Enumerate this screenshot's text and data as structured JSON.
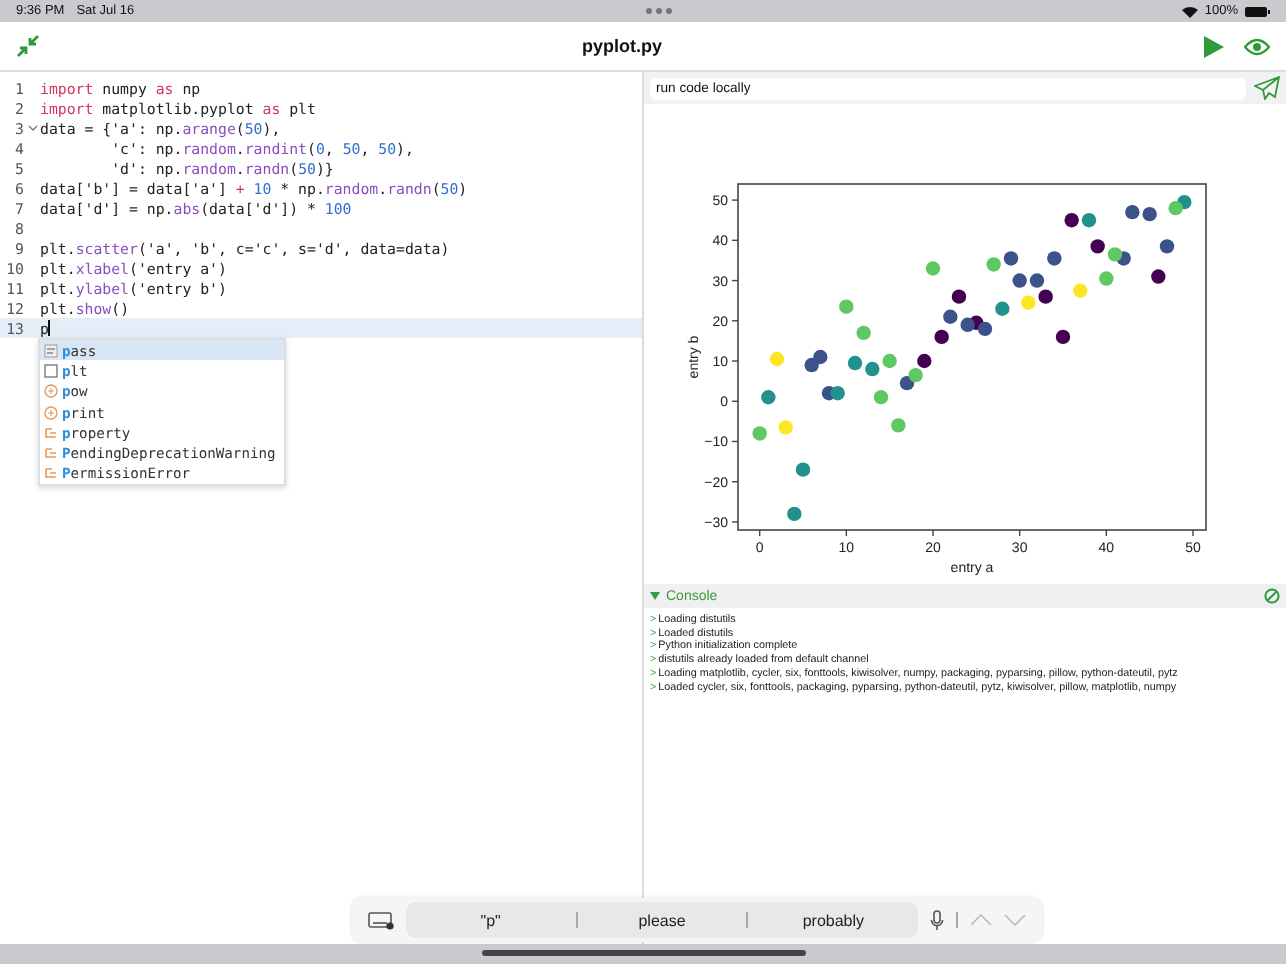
{
  "status_bar": {
    "time": "9:36 PM",
    "date": "Sat Jul 16",
    "battery": "100%"
  },
  "header": {
    "title": "pyplot.py"
  },
  "editor": {
    "lines": [
      {
        "number": "1",
        "tokens": [
          {
            "text": "import",
            "kind": "keyword"
          },
          {
            "text": " numpy ",
            "kind": "plain"
          },
          {
            "text": "as",
            "kind": "keyword"
          },
          {
            "text": " np",
            "kind": "plain"
          }
        ]
      },
      {
        "number": "2",
        "tokens": [
          {
            "text": "import",
            "kind": "keyword"
          },
          {
            "text": " matplotlib.pyplot ",
            "kind": "plain"
          },
          {
            "text": "as",
            "kind": "keyword"
          },
          {
            "text": " plt",
            "kind": "plain"
          }
        ]
      },
      {
        "number": "3",
        "foldable": true,
        "tokens": [
          {
            "text": "data = {'a': np.",
            "kind": "plain"
          },
          {
            "text": "arange",
            "kind": "call"
          },
          {
            "text": "(",
            "kind": "plain"
          },
          {
            "text": "50",
            "kind": "number"
          },
          {
            "text": "),",
            "kind": "plain"
          }
        ]
      },
      {
        "number": "4",
        "tokens": [
          {
            "text": "        'c': np.",
            "kind": "plain"
          },
          {
            "text": "random",
            "kind": "call"
          },
          {
            "text": ".",
            "kind": "plain"
          },
          {
            "text": "randint",
            "kind": "call"
          },
          {
            "text": "(",
            "kind": "plain"
          },
          {
            "text": "0",
            "kind": "number"
          },
          {
            "text": ", ",
            "kind": "plain"
          },
          {
            "text": "50",
            "kind": "number"
          },
          {
            "text": ", ",
            "kind": "plain"
          },
          {
            "text": "50",
            "kind": "number"
          },
          {
            "text": "),",
            "kind": "plain"
          }
        ]
      },
      {
        "number": "5",
        "tokens": [
          {
            "text": "        'd': np.",
            "kind": "plain"
          },
          {
            "text": "random",
            "kind": "call"
          },
          {
            "text": ".",
            "kind": "plain"
          },
          {
            "text": "randn",
            "kind": "call"
          },
          {
            "text": "(",
            "kind": "plain"
          },
          {
            "text": "50",
            "kind": "number"
          },
          {
            "text": ")}",
            "kind": "plain"
          }
        ]
      },
      {
        "number": "6",
        "tokens": [
          {
            "text": "data['b'] = data['a'] ",
            "kind": "plain"
          },
          {
            "text": "+ ",
            "kind": "keyword"
          },
          {
            "text": "10",
            "kind": "number"
          },
          {
            "text": " * np.",
            "kind": "plain"
          },
          {
            "text": "random",
            "kind": "call"
          },
          {
            "text": ".",
            "kind": "plain"
          },
          {
            "text": "randn",
            "kind": "call"
          },
          {
            "text": "(",
            "kind": "plain"
          },
          {
            "text": "50",
            "kind": "number"
          },
          {
            "text": ")",
            "kind": "plain"
          }
        ]
      },
      {
        "number": "7",
        "tokens": [
          {
            "text": "data['d'] = np.",
            "kind": "plain"
          },
          {
            "text": "abs",
            "kind": "call"
          },
          {
            "text": "(data['d']) * ",
            "kind": "plain"
          },
          {
            "text": "100",
            "kind": "number"
          }
        ]
      },
      {
        "number": "8"
      },
      {
        "number": "9",
        "tokens": [
          {
            "text": "plt.",
            "kind": "plain"
          },
          {
            "text": "scatter",
            "kind": "call"
          },
          {
            "text": "('a', 'b', c='c', s='d', data=data)",
            "kind": "plain"
          }
        ]
      },
      {
        "number": "10",
        "tokens": [
          {
            "text": "plt.",
            "kind": "plain"
          },
          {
            "text": "xlabel",
            "kind": "call"
          },
          {
            "text": "('entry a')",
            "kind": "plain"
          }
        ]
      },
      {
        "number": "11",
        "tokens": [
          {
            "text": "plt.",
            "kind": "plain"
          },
          {
            "text": "ylabel",
            "kind": "call"
          },
          {
            "text": "('entry b')",
            "kind": "plain"
          }
        ]
      },
      {
        "number": "12",
        "tokens": [
          {
            "text": "plt.",
            "kind": "plain"
          },
          {
            "text": "show",
            "kind": "call"
          },
          {
            "text": "()",
            "kind": "plain"
          }
        ]
      },
      {
        "number": "13",
        "current": true,
        "tokens": [
          {
            "text": "p",
            "kind": "plain"
          }
        ]
      }
    ],
    "completions": [
      {
        "kind": "keyword",
        "match": "p",
        "rest": "ass",
        "selected": true
      },
      {
        "kind": "variable",
        "match": "p",
        "rest": "lt",
        "selected": false
      },
      {
        "kind": "function",
        "match": "p",
        "rest": "ow",
        "selected": false
      },
      {
        "kind": "function",
        "match": "p",
        "rest": "rint",
        "selected": false
      },
      {
        "kind": "class",
        "match": "p",
        "rest": "roperty",
        "selected": false
      },
      {
        "kind": "class",
        "match": "P",
        "rest": "endingDeprecationWarning",
        "selected": false
      },
      {
        "kind": "class",
        "match": "P",
        "rest": "ermissionError",
        "selected": false
      }
    ]
  },
  "run_field": {
    "value": "run code locally"
  },
  "chart_data": {
    "type": "scatter",
    "xlabel": "entry a",
    "ylabel": "entry b",
    "xlim": [
      -2.5,
      51.5
    ],
    "ylim": [
      -32,
      54
    ],
    "xticks": [
      0,
      10,
      20,
      30,
      40,
      50
    ],
    "yticks": [
      -30,
      -20,
      -10,
      0,
      10,
      20,
      30,
      40,
      50
    ],
    "series": [
      {
        "color": "#440154",
        "x": [
          19,
          21,
          23,
          25,
          33,
          35,
          36,
          39,
          46
        ],
        "values": [
          10,
          16,
          26,
          19.5,
          26,
          16,
          45,
          38.5,
          31
        ]
      },
      {
        "color": "#3b528b",
        "x": [
          6,
          7,
          8,
          17,
          22,
          24,
          26,
          29,
          30,
          32,
          34,
          42,
          43,
          45,
          47
        ],
        "values": [
          9,
          11,
          2,
          4.5,
          21,
          19,
          18,
          35.5,
          30,
          30,
          35.5,
          35.5,
          47,
          46.5,
          38.5
        ]
      },
      {
        "color": "#21918c",
        "x": [
          1,
          4,
          5,
          9,
          11,
          13,
          28,
          38,
          49
        ],
        "values": [
          1,
          -28,
          -17,
          2,
          9.5,
          8,
          23,
          45,
          49.5
        ]
      },
      {
        "color": "#5ec962",
        "x": [
          0,
          10,
          12,
          14,
          15,
          16,
          18,
          20,
          27,
          40,
          41,
          48
        ],
        "values": [
          -8,
          23.5,
          17,
          1,
          10,
          -6,
          6.5,
          33,
          34,
          30.5,
          36.5,
          48
        ]
      },
      {
        "color": "#fde725",
        "x": [
          2,
          3,
          31,
          37
        ],
        "values": [
          10.5,
          -6.5,
          24.5,
          27.5
        ]
      }
    ]
  },
  "console": {
    "title": "Console",
    "expanded": true,
    "prompt": ">",
    "lines": [
      "Loading distutils",
      "Loaded distutils",
      "Python initialization complete",
      "distutils already loaded from default channel",
      "Loading matplotlib, cycler, six, fonttools, kiwisolver, numpy, packaging, pyparsing, pillow, python-dateutil, pytz",
      "Loaded cycler, six, fonttools, packaging, pyparsing, python-dateutil, pytz, kiwisolver, pillow, matplotlib, numpy"
    ]
  },
  "keyboard_bar": {
    "suggestions": [
      "\"p\"",
      "please",
      "probably"
    ]
  }
}
